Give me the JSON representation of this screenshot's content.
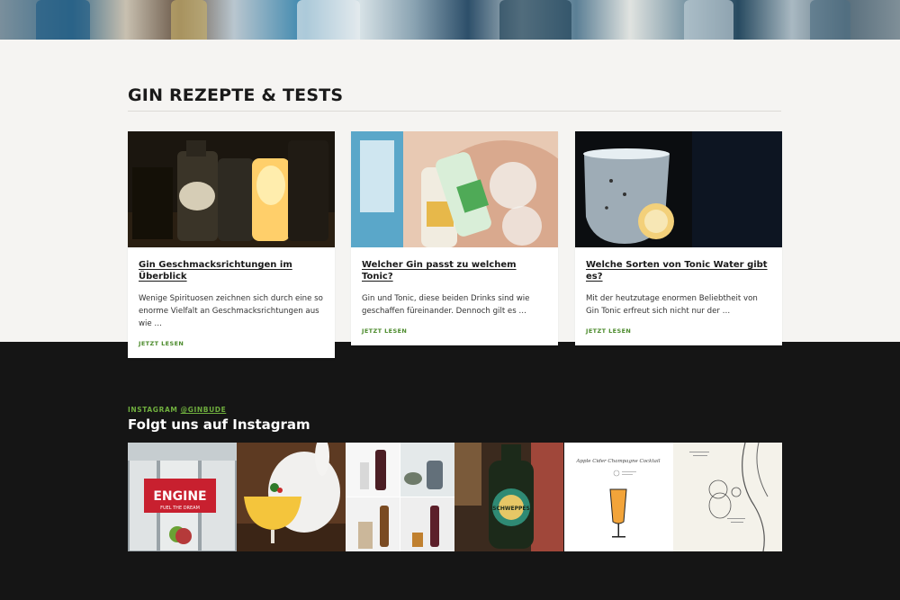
{
  "section": {
    "title": "GIN REZEPTE & TESTS"
  },
  "cards": [
    {
      "title": "Gin Geschmacksrichtungen im Überblick",
      "excerpt": "Wenige Spirituosen zeichnen sich durch eine so enorme Vielfalt an Geschmacksrichtungen aus wie …",
      "more": "JETZT LESEN"
    },
    {
      "title": "Welcher Gin passt zu welchem Tonic?",
      "excerpt": "Gin und Tonic, diese beiden Drinks sind wie geschaffen füreinander. Dennoch gilt es …",
      "more": "JETZT LESEN"
    },
    {
      "title": "Welche Sorten von Tonic Water gibt es?",
      "excerpt": "Mit der heutzutage enormen Beliebtheit von Gin Tonic erfreut sich nicht nur der …",
      "more": "JETZT LESEN"
    }
  ],
  "instagram": {
    "prefix": "INSTAGRAM ",
    "handle": "@GINBUDE",
    "title": "Folgt uns auf Instagram",
    "tiles": [
      {
        "icon": "slot-machine-engine-photo",
        "logo_text": "ENGINE",
        "logo_sub": "FUEL THE DREAM"
      },
      {
        "icon": "cocktail-bunny-photo"
      },
      {
        "icon": "bottle-grid-photo"
      },
      {
        "icon": "schweppes-bottle-photo",
        "label": "SCHWEPPES"
      },
      {
        "icon": "cocktail-recipe-card",
        "caption": "Apple Cider Champagne Cocktail"
      },
      {
        "icon": "winnie-the-pooh-sketch"
      }
    ]
  },
  "colors": {
    "accent_green": "#4a8a2a",
    "instagram_green": "#6fae3e",
    "dark_bg": "#151515",
    "light_bg": "#f5f4f2"
  }
}
